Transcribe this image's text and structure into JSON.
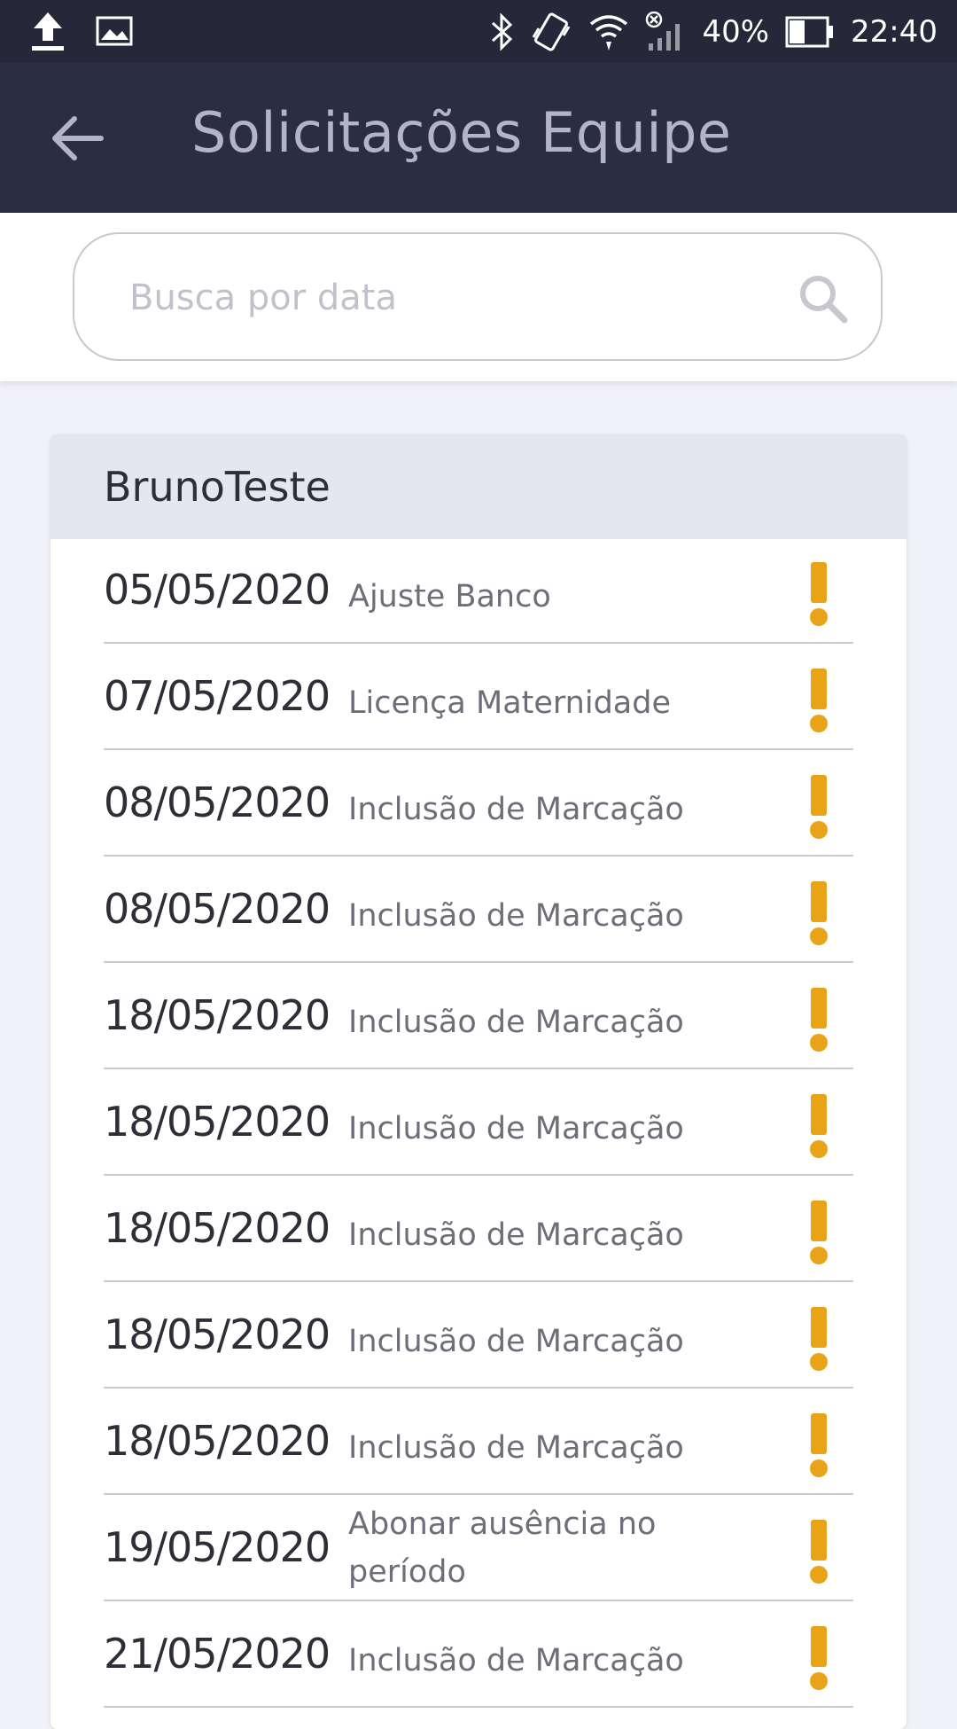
{
  "status_bar": {
    "battery": "40%",
    "time": "22:40",
    "icons": [
      "upload-icon",
      "image-icon",
      "bluetooth-icon",
      "vibrate-icon",
      "wifi-icon",
      "signal-icon",
      "battery-icon"
    ]
  },
  "app_bar": {
    "title": "Solicitações Equipe",
    "back_icon": "arrow-left-icon"
  },
  "search": {
    "placeholder": "Busca por data",
    "value": ""
  },
  "group": {
    "name": "BrunoTeste",
    "requests": [
      {
        "date": "05/05/2020",
        "type": "Ajuste Banco",
        "status_icon": "exclamation-icon"
      },
      {
        "date": "07/05/2020",
        "type": "Licença Maternidade",
        "status_icon": "exclamation-icon"
      },
      {
        "date": "08/05/2020",
        "type": "Inclusão de Marcação",
        "status_icon": "exclamation-icon"
      },
      {
        "date": "08/05/2020",
        "type": "Inclusão de Marcação",
        "status_icon": "exclamation-icon"
      },
      {
        "date": "18/05/2020",
        "type": "Inclusão de Marcação",
        "status_icon": "exclamation-icon"
      },
      {
        "date": "18/05/2020",
        "type": "Inclusão de Marcação",
        "status_icon": "exclamation-icon"
      },
      {
        "date": "18/05/2020",
        "type": "Inclusão de Marcação",
        "status_icon": "exclamation-icon"
      },
      {
        "date": "18/05/2020",
        "type": "Inclusão de Marcação",
        "status_icon": "exclamation-icon"
      },
      {
        "date": "18/05/2020",
        "type": "Inclusão de Marcação",
        "status_icon": "exclamation-icon"
      },
      {
        "date": "19/05/2020",
        "type": "Abonar ausência no período",
        "status_icon": "exclamation-icon"
      },
      {
        "date": "21/05/2020",
        "type": "Inclusão de Marcação",
        "status_icon": "exclamation-icon"
      }
    ]
  },
  "colors": {
    "status_bar": "#262739",
    "app_bar": "#2b2d42",
    "title": "#b3b4c6",
    "alert": "#e8a317",
    "background": "#f1f2f7"
  }
}
